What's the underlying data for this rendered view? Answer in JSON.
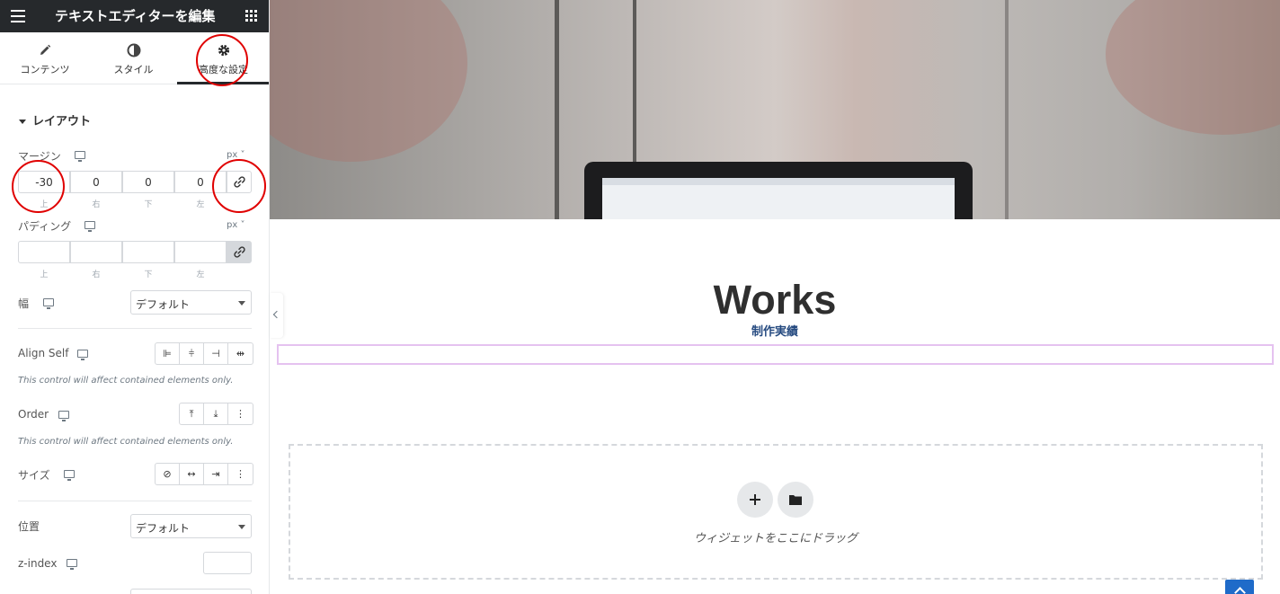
{
  "header": {
    "title": "テキストエディターを編集",
    "menu_icon": "hamburger-menu-icon",
    "apps_icon": "apps-grid-icon"
  },
  "tabs": [
    {
      "label": "コンテンツ",
      "icon": "pencil-icon"
    },
    {
      "label": "スタイル",
      "icon": "contrast-icon"
    },
    {
      "label": "高度な設定",
      "icon": "gear-icon",
      "active": true
    }
  ],
  "layout_section": {
    "title": "レイアウト",
    "margin": {
      "label": "マージン",
      "unit": "px",
      "values": [
        "-30",
        "0",
        "0",
        "0"
      ],
      "sides": [
        "上",
        "右",
        "下",
        "左"
      ]
    },
    "padding": {
      "label": "パディング",
      "unit": "px",
      "values": [
        "",
        "",
        "",
        ""
      ],
      "sides": [
        "上",
        "右",
        "下",
        "左"
      ]
    },
    "width": {
      "label": "幅",
      "value": "デフォルト"
    },
    "align_self": {
      "label": "Align Self",
      "note": "This control will affect contained elements only."
    },
    "order": {
      "label": "Order",
      "note": "This control will affect contained elements only."
    },
    "size": {
      "label": "サイズ"
    },
    "position": {
      "label": "位置",
      "value": "デフォルト"
    },
    "z_index": {
      "label": "z-index",
      "value": ""
    }
  },
  "canvas": {
    "heading": "Works",
    "subheading": "制作実績",
    "dropzone_text": "ウィジェットをここにドラッグ",
    "dropzone_add_icon": "plus-icon",
    "dropzone_template_icon": "folder-icon"
  },
  "colors": {
    "accent_red": "#e00000",
    "topbar": "#26292c",
    "subheading": "#254a80"
  }
}
